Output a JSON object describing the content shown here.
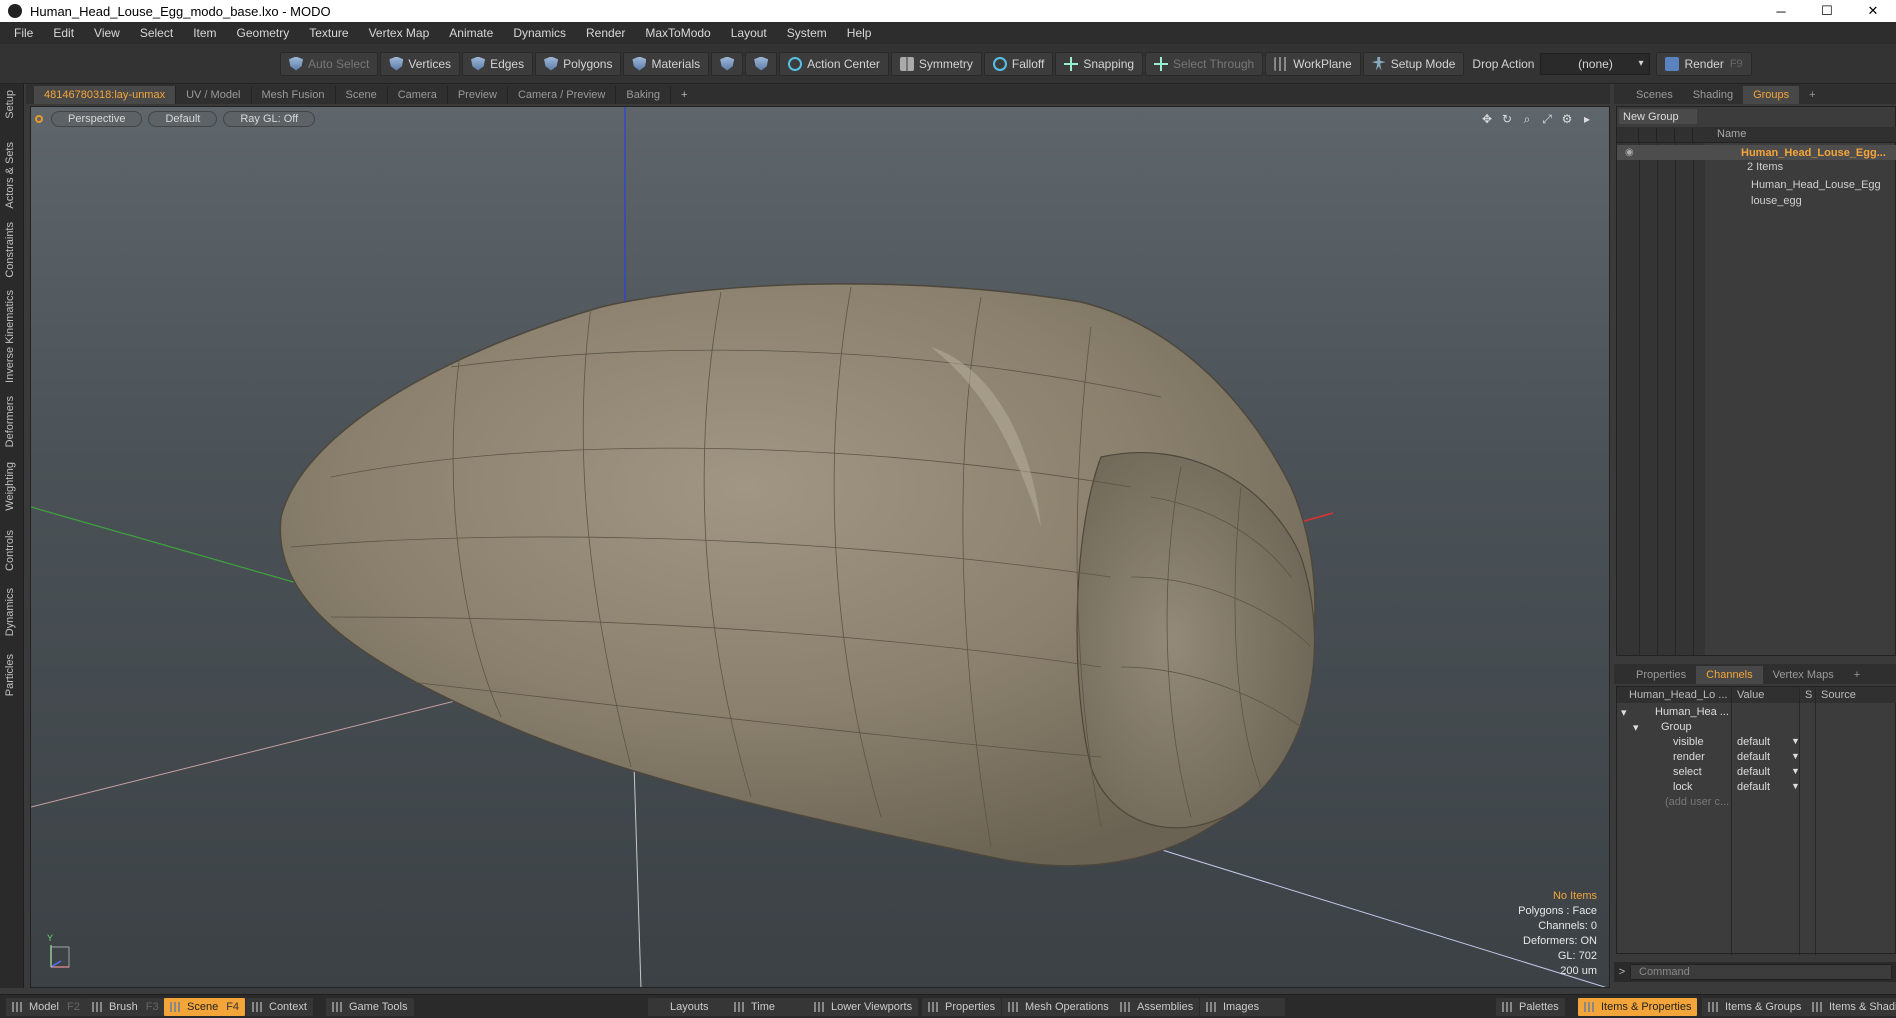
{
  "window": {
    "title": "Human_Head_Louse_Egg_modo_base.lxo - MODO",
    "minimize": "─",
    "maximize": "☐",
    "close": "✕"
  },
  "menu": [
    "File",
    "Edit",
    "View",
    "Select",
    "Item",
    "Geometry",
    "Texture",
    "Vertex Map",
    "Animate",
    "Dynamics",
    "Render",
    "MaxToModo",
    "Layout",
    "System",
    "Help"
  ],
  "toolbar": {
    "auto_select": "Auto Select",
    "vertices": "Vertices",
    "edges": "Edges",
    "polygons": "Polygons",
    "materials": "Materials",
    "action_center": "Action Center",
    "symmetry": "Symmetry",
    "falloff": "Falloff",
    "snapping": "Snapping",
    "select_through": "Select Through",
    "workplane": "WorkPlane",
    "setup_mode": "Setup Mode",
    "drop_action_label": "Drop Action",
    "drop_action_value": "(none)",
    "render": "Render",
    "render_key": "F9"
  },
  "left_tabs": [
    "Setup",
    "Actors & Sets",
    "Constraints",
    "Inverse Kinematics",
    "Deformers",
    "Weighting",
    "Controls",
    "Dynamics",
    "Particles"
  ],
  "viewport_tabs": [
    "48146780318:lay-unmax",
    "UV / Model",
    "Mesh Fusion",
    "Scene",
    "Camera",
    "Preview",
    "Camera / Preview",
    "Baking",
    "+"
  ],
  "viewport": {
    "view_mode": "Perspective",
    "shading": "Default",
    "raygl": "Ray GL: Off",
    "info": {
      "items": "No Items",
      "polygons": "Polygons : Face",
      "channels": "Channels: 0",
      "deformers": "Deformers: ON",
      "gl": "GL: 702",
      "scale": "200 um"
    },
    "gizmo_y": "Y"
  },
  "right_tabs": [
    "Scenes",
    "Shading",
    "Groups",
    "+"
  ],
  "groups": {
    "new_group": "New Group",
    "name_header": "Name",
    "root": "Human_Head_Louse_Egg...",
    "count": "2 Items",
    "children": [
      "Human_Head_Louse_Egg",
      "louse_egg"
    ]
  },
  "channel_tabs": [
    "Properties",
    "Channels",
    "Vertex Maps",
    "+"
  ],
  "channels": {
    "headers": {
      "name": "Human_Head_Lo ...",
      "value": "Value",
      "s": "S",
      "source": "Source"
    },
    "root": "Human_Hea ...",
    "group": "Group",
    "rows": [
      {
        "name": "visible",
        "value": "default"
      },
      {
        "name": "render",
        "value": "default"
      },
      {
        "name": "select",
        "value": "default"
      },
      {
        "name": "lock",
        "value": "default"
      }
    ],
    "add_user": "(add user c..."
  },
  "command": {
    "placeholder": "Command",
    "chevron": ">"
  },
  "bottom": {
    "model": "Model",
    "model_key": "F2",
    "brush": "Brush",
    "brush_key": "F3",
    "scene": "Scene",
    "scene_key": "F4",
    "context": "Context",
    "game_tools": "Game Tools",
    "layouts": "Layouts",
    "time": "Time",
    "lower_viewports": "Lower Viewports",
    "properties": "Properties",
    "mesh_operations": "Mesh Operations",
    "assemblies": "Assemblies",
    "images": "Images",
    "palettes": "Palettes",
    "items_properties": "Items & Properties",
    "items_groups": "Items & Groups",
    "items_shading": "Items & Shadi"
  },
  "colors": {
    "accent": "#f4a53a",
    "egg": "#8c8270"
  }
}
